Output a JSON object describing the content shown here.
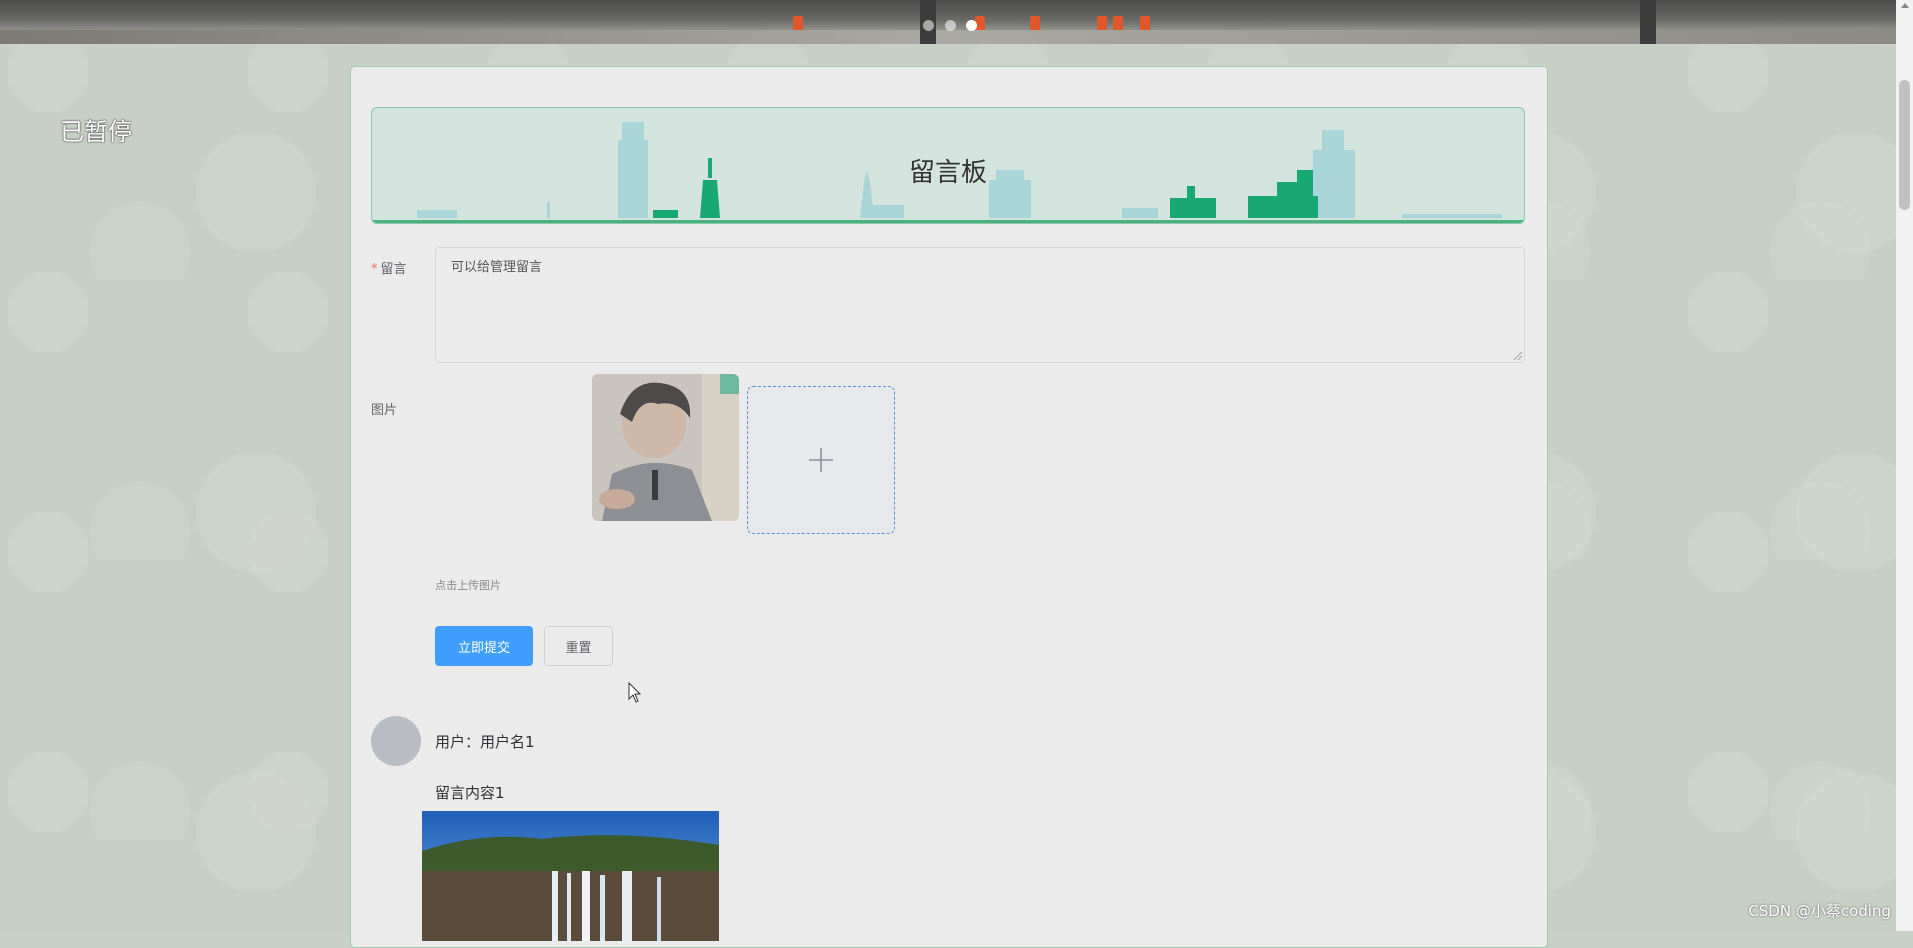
{
  "status": {
    "paused": "已暂停"
  },
  "board": {
    "title": "留言板"
  },
  "form": {
    "message_label": "留言",
    "required_mark": "*",
    "message_placeholder": "可以给管理留言",
    "image_label": "图片",
    "upload_tip": "点击上传图片",
    "upload_plus": "+",
    "submit_label": "立即提交",
    "reset_label": "重置"
  },
  "carousel": {
    "dots": 3,
    "active_index": 2
  },
  "messages": [
    {
      "user_text": "用户：用户名1",
      "content": "留言内容1"
    }
  ],
  "watermark": "CSDN @小蔡coding",
  "colors": {
    "primary": "#409eff",
    "board_bg": "#d3e4de",
    "skyline_green": "#18a874",
    "skyline_light": "#a9d4d8",
    "required": "#f56c6c"
  }
}
